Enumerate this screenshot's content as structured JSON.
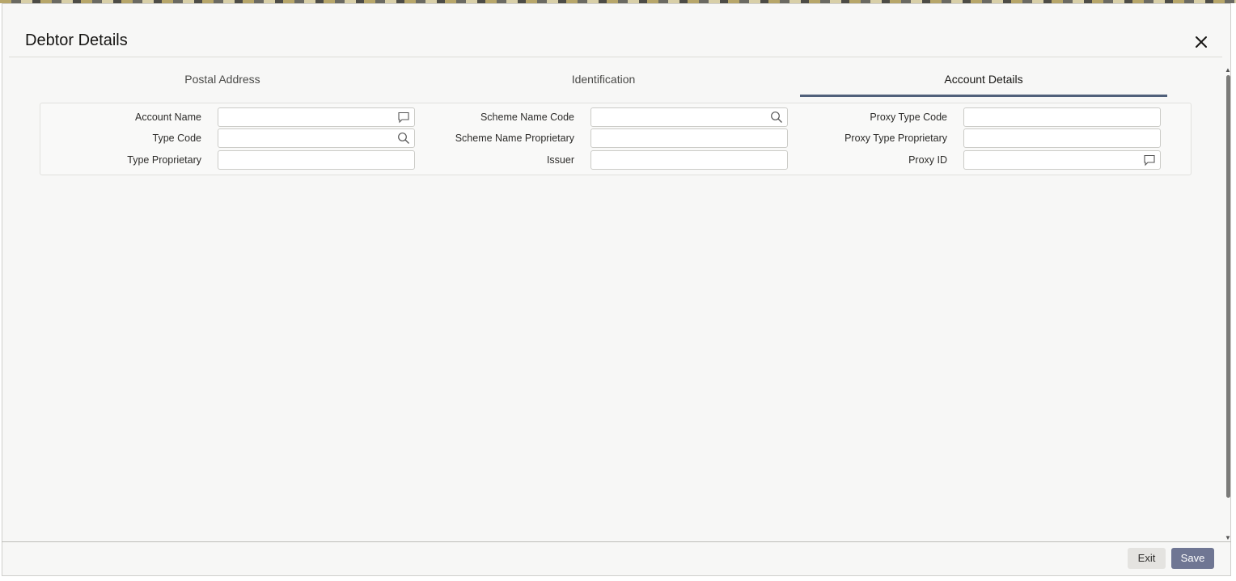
{
  "dialog": {
    "title": "Debtor Details"
  },
  "tabs": [
    {
      "label": "Postal Address",
      "active": false
    },
    {
      "label": "Identification",
      "active": false
    },
    {
      "label": "Account Details",
      "active": true
    }
  ],
  "fields": {
    "account_name": {
      "label": "Account Name",
      "value": "",
      "icon": "comment-icon"
    },
    "type_code": {
      "label": "Type Code",
      "value": "",
      "icon": "search-icon"
    },
    "type_proprietary": {
      "label": "Type Proprietary",
      "value": ""
    },
    "scheme_name_code": {
      "label": "Scheme Name Code",
      "value": "",
      "icon": "search-icon"
    },
    "scheme_name_proprietary": {
      "label": "Scheme Name Proprietary",
      "value": ""
    },
    "issuer": {
      "label": "Issuer",
      "value": ""
    },
    "proxy_type_code": {
      "label": "Proxy Type Code",
      "value": ""
    },
    "proxy_type_proprietary": {
      "label": "Proxy Type Proprietary",
      "value": ""
    },
    "proxy_id": {
      "label": "Proxy ID",
      "value": "",
      "icon": "comment-icon"
    }
  },
  "footer": {
    "exit_label": "Exit",
    "save_label": "Save"
  },
  "colors": {
    "active_tab_underline": "#50607a",
    "save_button": "#6f7693"
  }
}
